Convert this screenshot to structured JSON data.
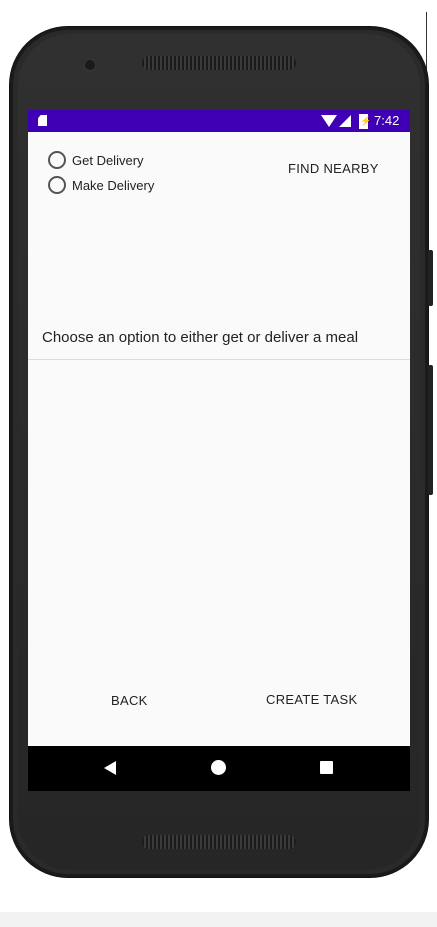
{
  "status_bar": {
    "time": "7:42",
    "icons": [
      "sd-card-icon",
      "wifi-icon",
      "cell-signal-icon",
      "battery-icon"
    ],
    "color": "#3f00b5"
  },
  "options": [
    {
      "label": "Get Delivery",
      "selected": false
    },
    {
      "label": "Make Delivery",
      "selected": false
    }
  ],
  "find_nearby_label": "FIND NEARBY",
  "prompt_text": "Choose an option to either get or deliver a meal",
  "footer": {
    "back_label": "BACK",
    "create_task_label": "CREATE TASK"
  },
  "nav_bar": {
    "buttons": [
      "back-icon",
      "home-icon",
      "recents-icon"
    ]
  }
}
